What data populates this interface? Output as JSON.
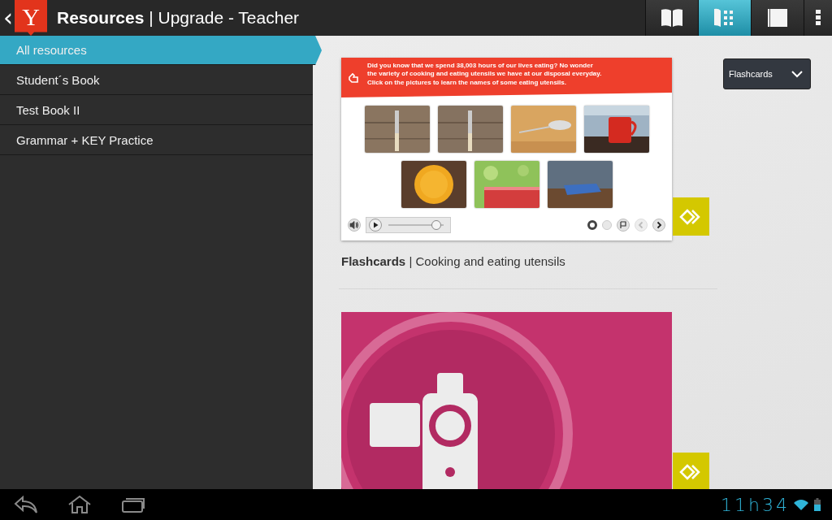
{
  "app_bar": {
    "back": "‹",
    "logo": "Y",
    "title": "**Resources** | Upgrade - Teacher"
  },
  "toolbar": [
    {
      "kind": "book",
      "selected": false
    },
    {
      "kind": "grid",
      "selected": true
    },
    {
      "kind": "page",
      "selected": false
    },
    {
      "kind": "menu",
      "selected": false
    }
  ],
  "sidebar": {
    "items": [
      {
        "label": "All resources",
        "selected": true
      },
      {
        "label": "Student´s Book",
        "selected": false
      },
      {
        "label": "Test Book II",
        "selected": false
      },
      {
        "label": "Grammar + KEY Practice",
        "selected": false
      }
    ]
  },
  "filter": {
    "value": "Flashcards"
  },
  "resources": [
    {
      "kind": "flashcards",
      "caption": "**Flashcards** | Cooking and eating utensils",
      "instructions": [
        "Did you know that we spend 38,003 hours of our lives eating? No wonder",
        "the variety of cooking and eating utensils we have at our disposal everyday.",
        "Click on the pictures to learn the names of some eating utensils."
      ],
      "photos": [
        {
          "kind": "fork"
        },
        {
          "kind": "knife"
        },
        {
          "kind": "spoon"
        },
        {
          "kind": "cup"
        },
        {
          "kind": "plate"
        },
        {
          "kind": "tablecloth"
        },
        {
          "kind": "napkin"
        }
      ],
      "audio": {
        "level": 0.95
      },
      "pages": [
        {
          "selected": true
        },
        {
          "selected": false
        }
      ]
    },
    {
      "kind": "video"
    }
  ],
  "status_bar": {
    "time": "11h34"
  }
}
